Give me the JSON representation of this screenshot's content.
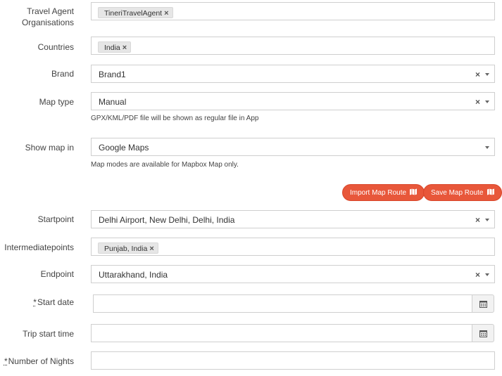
{
  "form": {
    "travel_agent": {
      "label_line1": "Travel Agent",
      "label_line2": "Organisations",
      "tags": [
        "TineriTravelAgent"
      ]
    },
    "countries": {
      "label": "Countries",
      "tags": [
        "India"
      ]
    },
    "brand": {
      "label": "Brand",
      "value": "Brand1"
    },
    "map_type": {
      "label": "Map type",
      "value": "Manual",
      "help": "GPX/KML/PDF file will be shown as regular file in App"
    },
    "show_map_in": {
      "label": "Show map in",
      "value": "Google Maps",
      "help": "Map modes are available for Mapbox Map only."
    },
    "buttons": {
      "import": "Import Map Route",
      "save": "Save Map Route"
    },
    "startpoint": {
      "label": "Startpoint",
      "value": "Delhi Airport, New Delhi, Delhi, India"
    },
    "intermediatepoints": {
      "label": "Intermediatepoints",
      "tags": [
        "Punjab, India"
      ]
    },
    "endpoint": {
      "label": "Endpoint",
      "value": "Uttarakhand, India"
    },
    "start_date": {
      "required_mark": "*",
      "label": "Start date",
      "value": ""
    },
    "trip_start_time": {
      "label": "Trip start time",
      "value": ""
    },
    "number_of_nights": {
      "required_mark": "*",
      "label": "Number of Nights",
      "value": ""
    }
  },
  "symbols": {
    "tag_remove": "×",
    "clear": "×"
  },
  "colors": {
    "accent": "#e8573a"
  },
  "icons": {
    "map": "map-icon",
    "calendar": "calendar-icon",
    "caret": "chevron-down-icon"
  }
}
